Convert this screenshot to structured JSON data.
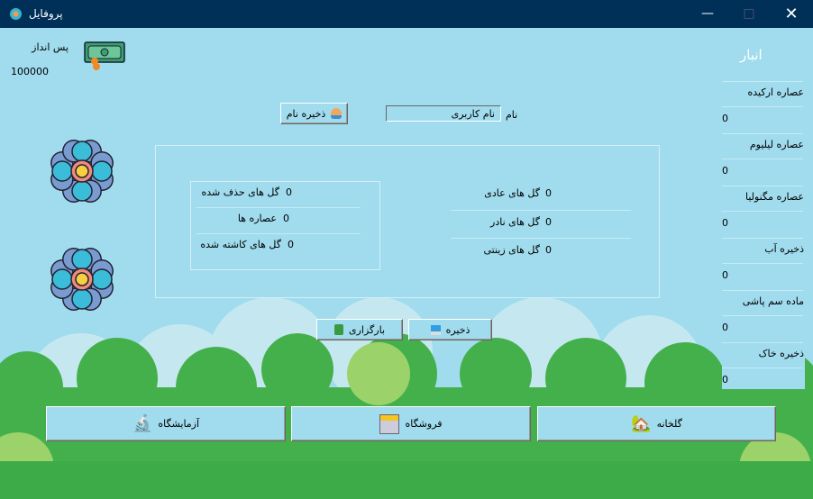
{
  "window": {
    "title": "پروفایل"
  },
  "savings": {
    "label": "پس انداز",
    "value": "100000"
  },
  "profile": {
    "name_label": "نام",
    "name_value": "نام کاربری",
    "save_name_button": "ذخیره نام"
  },
  "stats": {
    "left": [
      {
        "label": "گل های حذف شده",
        "value": "0"
      },
      {
        "label": "عصاره ها",
        "value": "0"
      },
      {
        "label": "گل های کاشته شده",
        "value": "0"
      }
    ],
    "right": [
      {
        "label": "گل های عادی",
        "value": "0"
      },
      {
        "label": "گل های نادر",
        "value": "0"
      },
      {
        "label": "گل های زینتی",
        "value": "0"
      }
    ]
  },
  "actions": {
    "load": "بارگزاری",
    "save": "ذخیره"
  },
  "warehouse": {
    "title": "انبار",
    "items": [
      {
        "label": "عصاره ارکیده",
        "value": "0"
      },
      {
        "label": "عصاره لیلیوم",
        "value": "0"
      },
      {
        "label": "عصاره مگنولیا",
        "value": "0"
      },
      {
        "label": "ذخیره آب",
        "value": "0"
      },
      {
        "label": "ماده سم پاشی",
        "value": "0"
      },
      {
        "label": "ذخیره خاک",
        "value": "0"
      }
    ]
  },
  "nav": {
    "lab": "آزمایشگاه",
    "shop": "فروشگاه",
    "greenhouse": "گلخانه"
  }
}
